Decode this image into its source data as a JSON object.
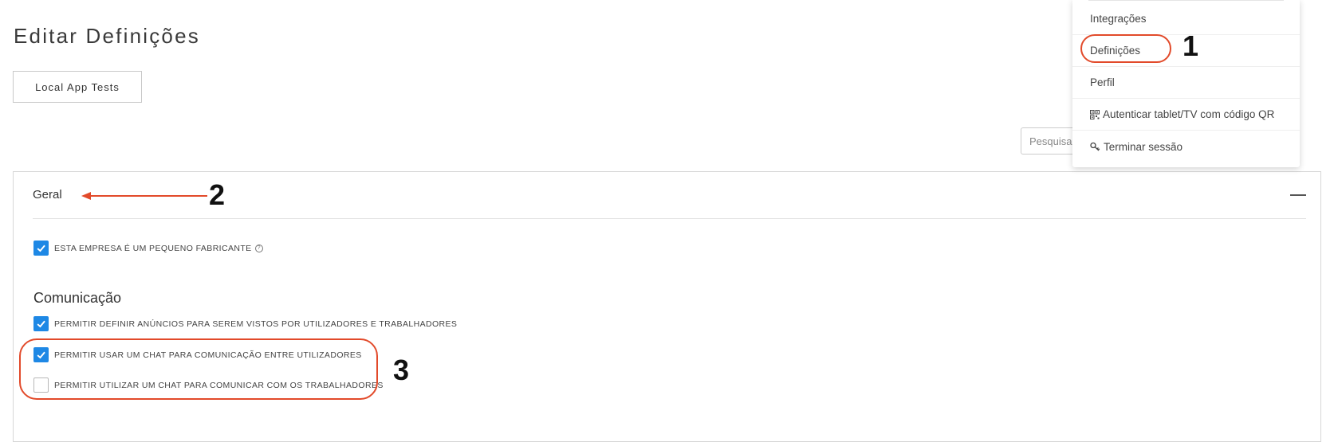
{
  "page": {
    "title": "Editar Definições"
  },
  "tab": {
    "label": "Local App Tests"
  },
  "search": {
    "placeholder": "Pesquisar"
  },
  "panel": {
    "title": "Geral",
    "small_manufacturer_label": "ESTA EMPRESA É UM PEQUENO FABRICANTE",
    "small_manufacturer_checked": true,
    "communication_heading": "Comunicação",
    "options": [
      {
        "label": "PERMITIR DEFINIR ANÚNCIOS PARA SEREM VISTOS POR UTILIZADORES E TRABALHADORES",
        "checked": true
      },
      {
        "label": "PERMITIR USAR UM CHAT PARA COMUNICAÇÃO ENTRE UTILIZADORES",
        "checked": true
      },
      {
        "label": "PERMITIR UTILIZAR UM CHAT PARA COMUNICAR COM OS TRABALHADORES",
        "checked": false
      }
    ]
  },
  "menu": {
    "items": [
      {
        "label": "Integrações"
      },
      {
        "label": "Definições"
      },
      {
        "label": "Perfil"
      },
      {
        "label": "Autenticar tablet/TV com código QR",
        "icon": "qr-code-icon"
      },
      {
        "label": "Terminar sessão",
        "icon": "key-icon"
      }
    ]
  },
  "annotations": {
    "callout_1": "1",
    "callout_2": "2",
    "callout_3": "3",
    "color": "#e24a2a"
  },
  "colors": {
    "accent": "#1e88e5"
  }
}
